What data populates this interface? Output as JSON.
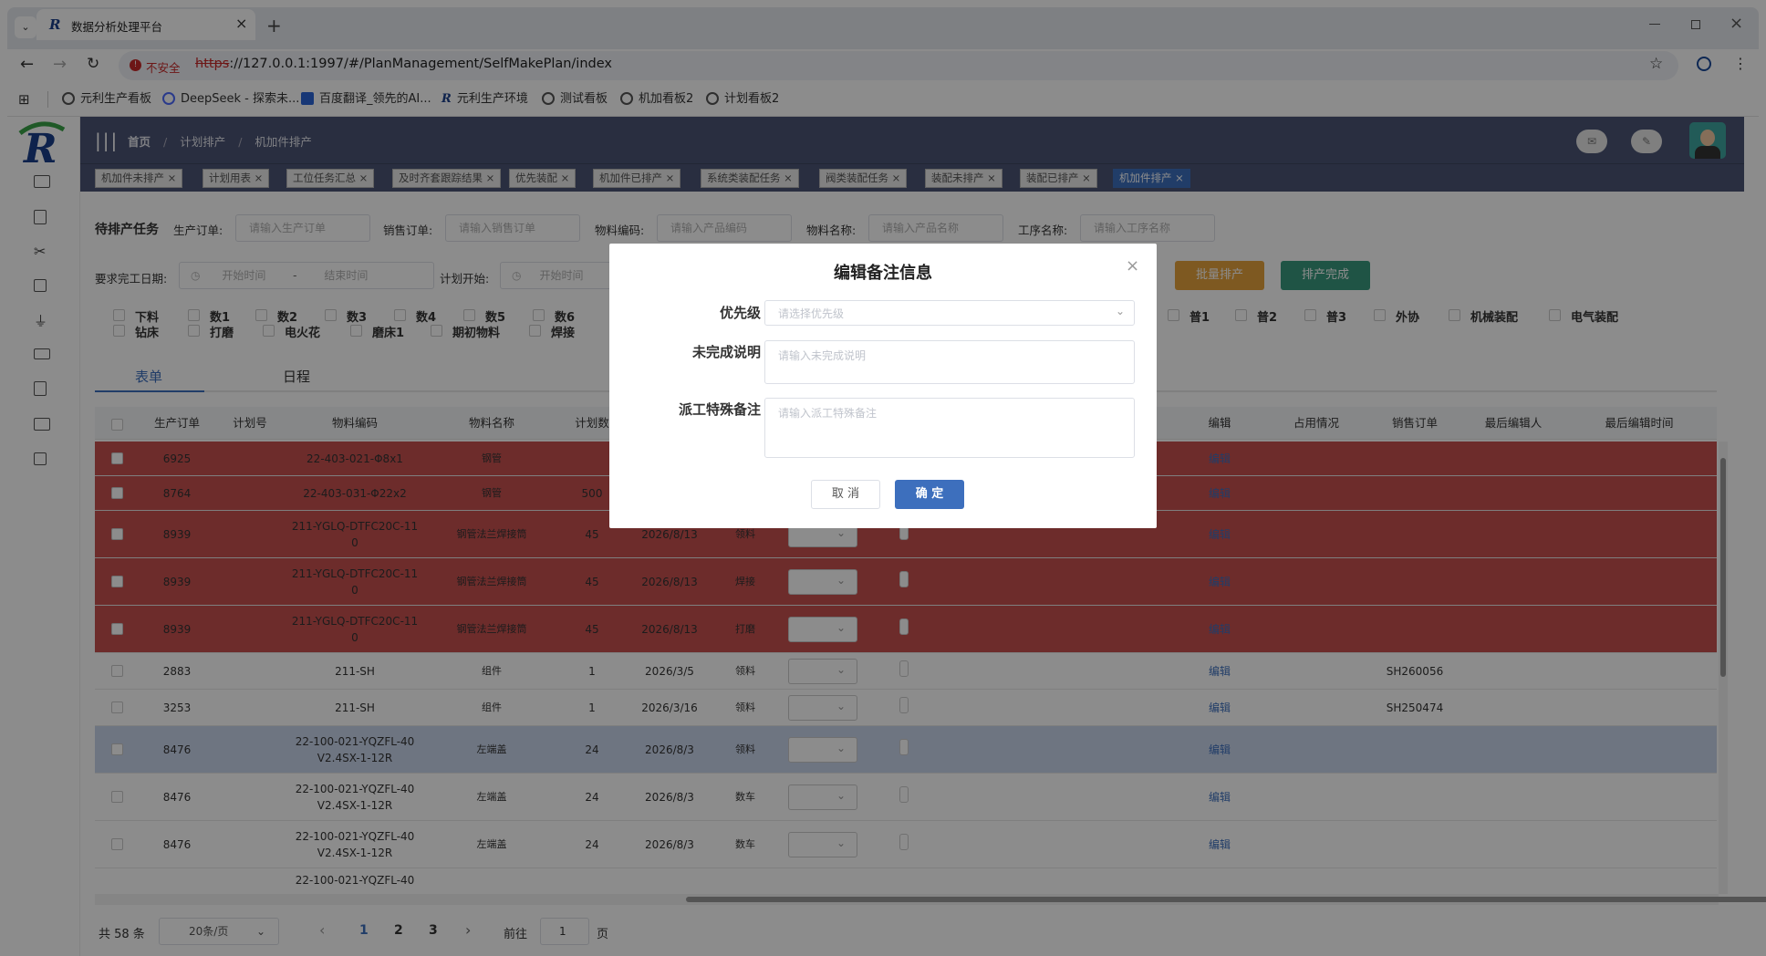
{
  "browser": {
    "tab_title": "数据分析处理平台",
    "new_tab": "+",
    "security": "不安全",
    "url_scheme": "https",
    "url_rest": "://127.0.0.1:1997/#/PlanManagement/SelfMakePlan/index",
    "bookmarks": [
      "元利生产看板",
      "DeepSeek - 探索未...",
      "百度翻译_领先的AI...",
      "元利生产环境",
      "测试看板",
      "机加看板2",
      "计划看板2"
    ]
  },
  "header": {
    "breadcrumb": [
      "首页",
      "计划排产",
      "机加件排产"
    ]
  },
  "tags": [
    "机加件未排产",
    "计划用表",
    "工位任务汇总",
    "及时齐套跟踪结果",
    "优先装配",
    "机加件已排产",
    "系统类装配任务",
    "阀类装配任务",
    "装配未排产",
    "装配已排产",
    "机加件排产"
  ],
  "filters": {
    "section_title": "待排产任务",
    "prod_order_label": "生产订单:",
    "prod_order_ph": "请输入生产订单",
    "sales_order_label": "销售订单:",
    "sales_order_ph": "请输入销售订单",
    "material_code_label": "物料编码:",
    "material_code_ph": "请输入产品编码",
    "material_name_label": "物料名称:",
    "material_name_ph": "请输入产品名称",
    "process_label": "工序名称:",
    "process_ph": "请输入工序名称",
    "due_label": "要求完工日期:",
    "start_ph": "开始时间",
    "range_sep": "-",
    "end_ph": "结束时间",
    "plan_start_label": "计划开始:",
    "plan_start_ph": "开始时间",
    "batch_button": "批量排产",
    "done_button": "排产完成"
  },
  "checkboxes_row1": [
    "下料",
    "数1",
    "数2",
    "数3",
    "数4",
    "数5",
    "数6"
  ],
  "checkboxes_row2": [
    "钻床",
    "打磨",
    "电火花",
    "磨床1",
    "期初物料",
    "焊接"
  ],
  "checkboxes_right": [
    "普1",
    "普2",
    "普3",
    "外协",
    "机械装配",
    "电气装配"
  ],
  "view_tabs": [
    "表单",
    "日程"
  ],
  "table": {
    "headers_left": [
      "生产订单",
      "计划号",
      "物料编码",
      "物料名称",
      "计划数"
    ],
    "headers_right": [
      "编辑",
      "占用情况",
      "销售订单",
      "最后编辑人",
      "最后编辑时间"
    ],
    "rows": [
      {
        "order": "6925",
        "plan": "",
        "code": "22-403-021-Φ8x1",
        "name": "钢管",
        "qty": "",
        "date": "",
        "proc": "",
        "edit": "编辑",
        "sales": "",
        "status": "red"
      },
      {
        "order": "8764",
        "plan": "",
        "code": "22-403-031-Φ22x2",
        "name": "钢管",
        "qty": "500",
        "date": "",
        "proc": "",
        "edit": "编辑",
        "sales": "",
        "status": "red"
      },
      {
        "order": "8939",
        "plan": "",
        "code": "211-YGLQ-DTFC20C-11\n0",
        "name": "钢管法兰焊接筒",
        "qty": "45",
        "date": "2026/8/13",
        "proc": "领料",
        "edit": "编辑",
        "sales": "",
        "status": "red"
      },
      {
        "order": "8939",
        "plan": "",
        "code": "211-YGLQ-DTFC20C-11\n0",
        "name": "钢管法兰焊接筒",
        "qty": "45",
        "date": "2026/8/13",
        "proc": "焊接",
        "edit": "编辑",
        "sales": "",
        "status": "red"
      },
      {
        "order": "8939",
        "plan": "",
        "code": "211-YGLQ-DTFC20C-11\n0",
        "name": "钢管法兰焊接筒",
        "qty": "45",
        "date": "2026/8/13",
        "proc": "打磨",
        "edit": "编辑",
        "sales": "",
        "status": "red"
      },
      {
        "order": "2883",
        "plan": "",
        "code": "211-SH",
        "name": "组件",
        "qty": "1",
        "date": "2026/3/5",
        "proc": "领料",
        "edit": "编辑",
        "sales": "SH260056",
        "status": "normal"
      },
      {
        "order": "3253",
        "plan": "",
        "code": "211-SH",
        "name": "组件",
        "qty": "1",
        "date": "2026/3/16",
        "proc": "领料",
        "edit": "编辑",
        "sales": "SH250474",
        "status": "normal"
      },
      {
        "order": "8476",
        "plan": "",
        "code": "22-100-021-YQZFL-40\nV2.4SX-1-12R",
        "name": "左端盖",
        "qty": "24",
        "date": "2026/8/3",
        "proc": "领料",
        "edit": "编辑",
        "sales": "",
        "status": "blue"
      },
      {
        "order": "8476",
        "plan": "",
        "code": "22-100-021-YQZFL-40\nV2.4SX-1-12R",
        "name": "左端盖",
        "qty": "24",
        "date": "2026/8/3",
        "proc": "数车",
        "edit": "编辑",
        "sales": "",
        "status": "normal"
      },
      {
        "order": "8476",
        "plan": "",
        "code": "22-100-021-YQZFL-40\nV2.4SX-1-12R",
        "name": "左端盖",
        "qty": "24",
        "date": "2026/8/3",
        "proc": "数车",
        "edit": "编辑",
        "sales": "",
        "status": "normal"
      }
    ],
    "partial_row_code": "22-100-021-YQZFL-40"
  },
  "pagination": {
    "total": "共 58 条",
    "page_size": "20条/页",
    "pages": [
      "1",
      "2",
      "3"
    ],
    "prev": "‹",
    "next": "›",
    "goto_label": "前往",
    "goto_value": "1",
    "goto_suffix": "页"
  },
  "dialog": {
    "title": "编辑备注信息",
    "priority_label": "优先级",
    "priority_ph": "请选择优先级",
    "incomplete_label": "未完成说明",
    "incomplete_ph": "请输入未完成说明",
    "special_label": "派工特殊备注",
    "special_ph": "请输入派工特殊备注",
    "cancel": "取 消",
    "confirm": "确 定"
  },
  "colors": {
    "header": "#4c5575",
    "row_red": "#c7504f",
    "row_blue": "#c9d5ec",
    "primary": "#3d6fbd",
    "batch": "#e6a23c",
    "done": "#3a9a7e"
  },
  "icons": [
    "chevron-down-icon",
    "close-icon",
    "back-icon",
    "forward-icon",
    "reload-icon",
    "star-icon",
    "profile-icon",
    "menu-dots-icon",
    "apps-icon",
    "mail-icon",
    "edit-icon",
    "avatar",
    "calendar-icon"
  ]
}
